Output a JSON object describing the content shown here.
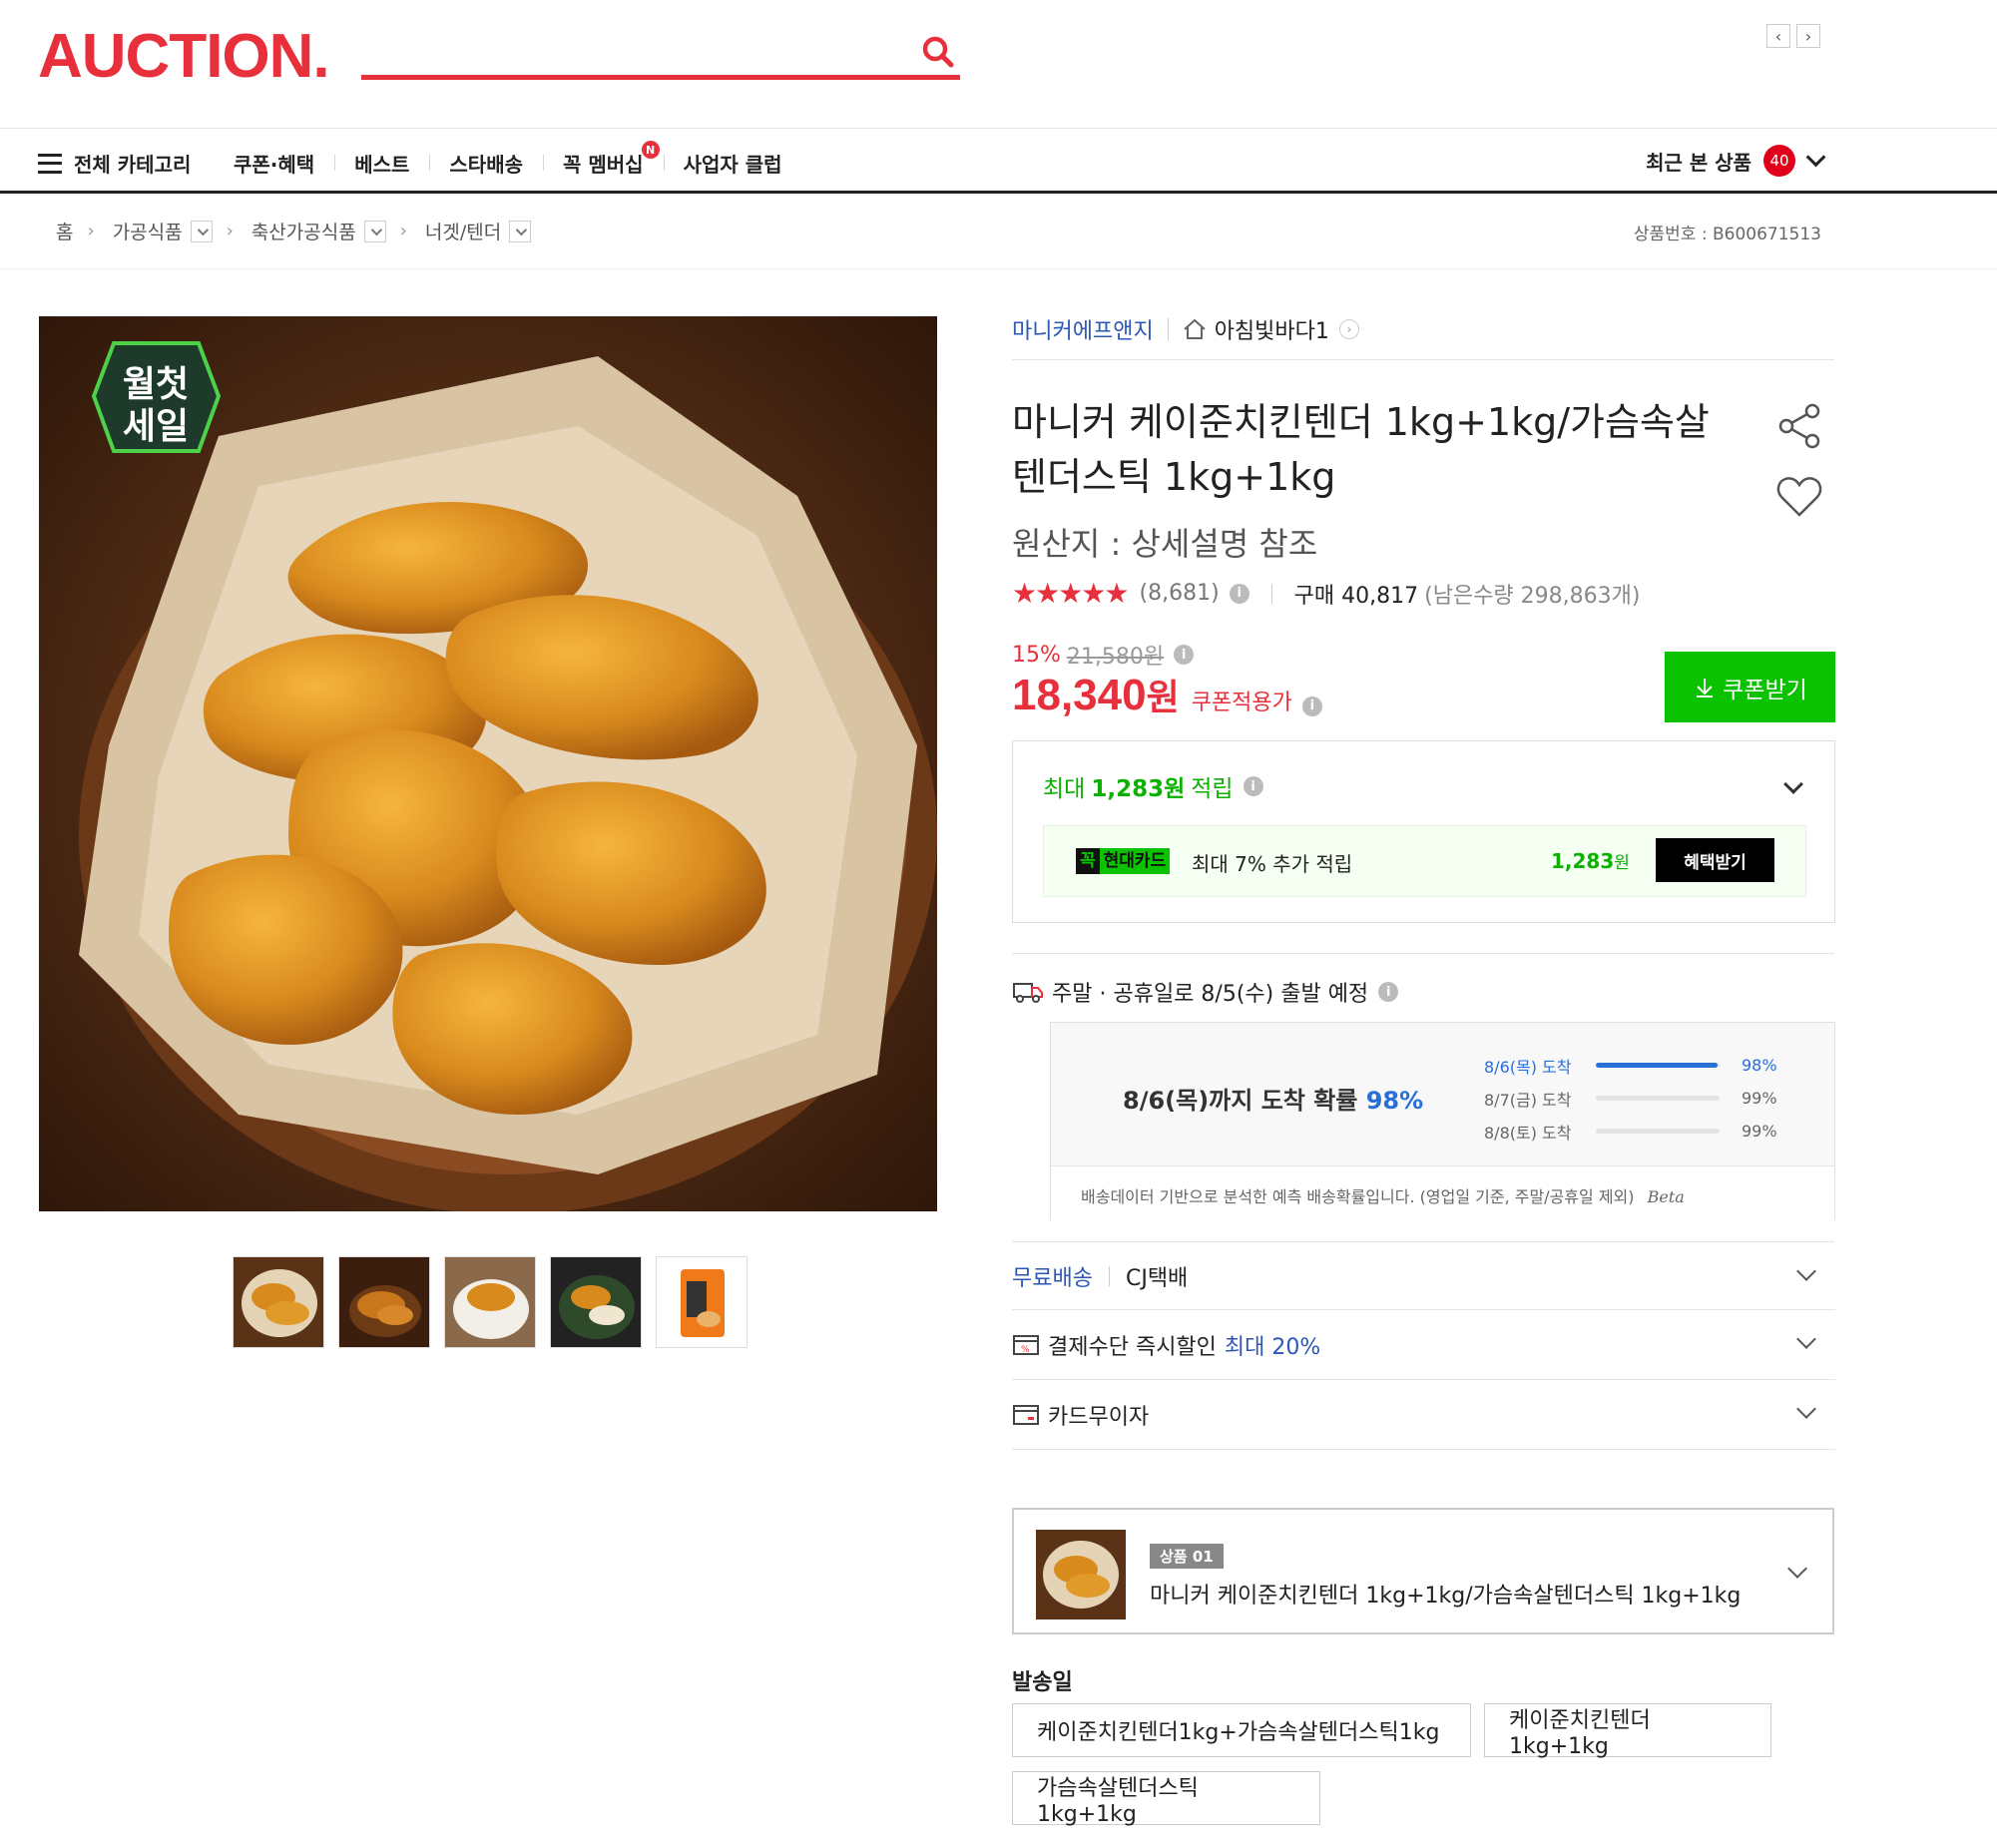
{
  "header": {
    "logo": "AUCTION.",
    "search": {
      "value": "",
      "placeholder": ""
    },
    "pager": {
      "prev": "‹",
      "next": "›"
    }
  },
  "gnb": {
    "all_category": "전체 카테고리",
    "items": [
      "쿠폰·혜택",
      "베스트",
      "스타배송",
      "꼭 멤버십",
      "사업자 클럽"
    ],
    "membership_badge": "N",
    "recent_label": "최근 본 상품",
    "recent_count": "40"
  },
  "breadcrumb": {
    "home": "홈",
    "levels": [
      "가공식품",
      "축산가공식품",
      "너겟/텐더"
    ],
    "product_no_label": "상품번호 :",
    "product_no": "B600671513"
  },
  "product": {
    "sale_badge": [
      "월첫",
      "세일"
    ],
    "brand": "마니커에프앤지",
    "shop": "아침빛바다1",
    "title": "마니커 케이준치킨텐더 1kg+1kg/가슴속살텐더스틱 1kg+1kg",
    "origin": "원산지 : 상세설명 참조",
    "stars": "★★★★★",
    "rating_score": 5,
    "review_count": "(8,681)",
    "buy_count": "구매 40,817",
    "remaining": "(남은수량 298,863개)",
    "discount_pct": "15%",
    "original_price": "21,580원",
    "price": "18,340",
    "price_unit": "원",
    "price_label": "쿠폰적용가",
    "coupon_button": "쿠폰받기"
  },
  "reward": {
    "prefix": "최대",
    "amount": "1,283원",
    "suffix": "적립",
    "card_badge_k": "꼭",
    "card_badge_name": "현대카드",
    "card_text": "최대 7% 추가 적립",
    "card_amount": "1,283",
    "card_amount_unit": "원",
    "card_button": "혜택받기"
  },
  "shipping": {
    "notice": "주말 · 공휴일로 8/5(수) 출발 예정",
    "headline_prefix": "8/6(목)까지 도착 확률",
    "headline_pct": "98%",
    "rows": [
      {
        "date": "8/6(목) 도착",
        "pct": "98%",
        "fill": 0.98
      },
      {
        "date": "8/7(금) 도착",
        "pct": "99%",
        "fill": 0.0
      },
      {
        "date": "8/8(토) 도착",
        "pct": "99%",
        "fill": 0.0
      }
    ],
    "footnote": "배송데이터 기반으로 분석한 예측 배송확률입니다. (영업일 기준, 주말/공휴일 제외)",
    "beta": "Beta"
  },
  "options": {
    "free_shipping": "무료배송",
    "courier": "CJ택배",
    "payment_discount": "결제수단 즉시할인",
    "payment_discount_max": "최대 20%",
    "installment": "카드무이자"
  },
  "selected": {
    "tag": "상품 01",
    "name": "마니커 케이준치킨텐더 1kg+1kg/가슴속살텐더스틱 1kg+1kg"
  },
  "ship_date": {
    "label": "발송일",
    "choices": [
      "케이준치킨텐더1kg+가슴속살텐더스틱1kg",
      "케이준치킨텐더1kg+1kg",
      "가슴속살텐더스틱1kg+1kg"
    ]
  },
  "colors": {
    "brand_red": "#e8303d",
    "green": "#0ac200",
    "blue": "#2870d8"
  }
}
